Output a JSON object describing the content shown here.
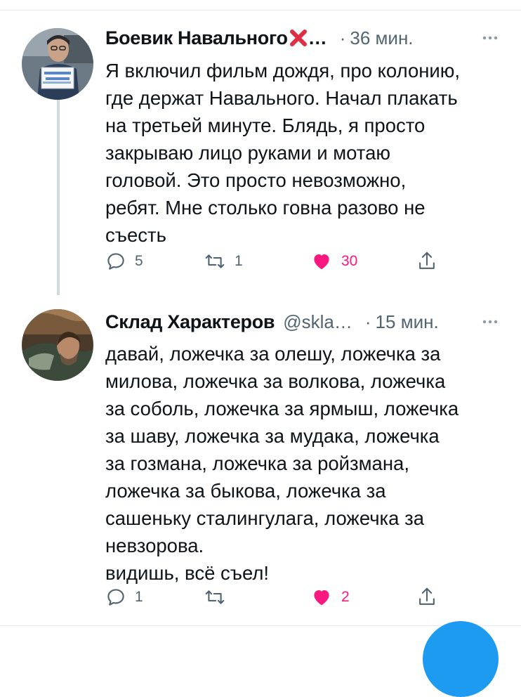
{
  "tweets": [
    {
      "author_name": "Боевик Навального",
      "name_emoji": "cross-mark-emoji",
      "truncation": "…",
      "time": "36 мин.",
      "text": "Я включил фильм дождя, про колонию,\nгде держат Навального. Начал плакать\nна третьей минуте. Блядь, я просто\nзакрываю лицо руками и мотаю\nголовой. Это просто невозможно,\nребят. Мне столько говна разово не\nсъесть",
      "actions": {
        "replies": "5",
        "retweets": "1",
        "likes": "30",
        "liked": true
      }
    },
    {
      "author_name": "Склад Характеров",
      "handle": "@skla…",
      "time": "15 мин.",
      "text": "давай, ложечка за олешу, ложечка за\nмилова, ложечка за волкова, ложечка\nза соболь, ложечка за ярмыш, ложечка\nза шаву, ложечка за мудака, ложечка\nза гозмана, ложечка за ройзмана,\nложечка за быкова, ложечка за\nсашеньку сталингулага, ложечка за\nневзорова.\nвидишь, всё съел!",
      "actions": {
        "replies": "1",
        "retweets": "",
        "likes": "2",
        "liked": true
      }
    }
  ],
  "separator": "·",
  "colors": {
    "like_active": "#f91880",
    "meta_gray": "#536471",
    "thread_line": "#cfd9de",
    "accent": "#1d9bf0"
  }
}
